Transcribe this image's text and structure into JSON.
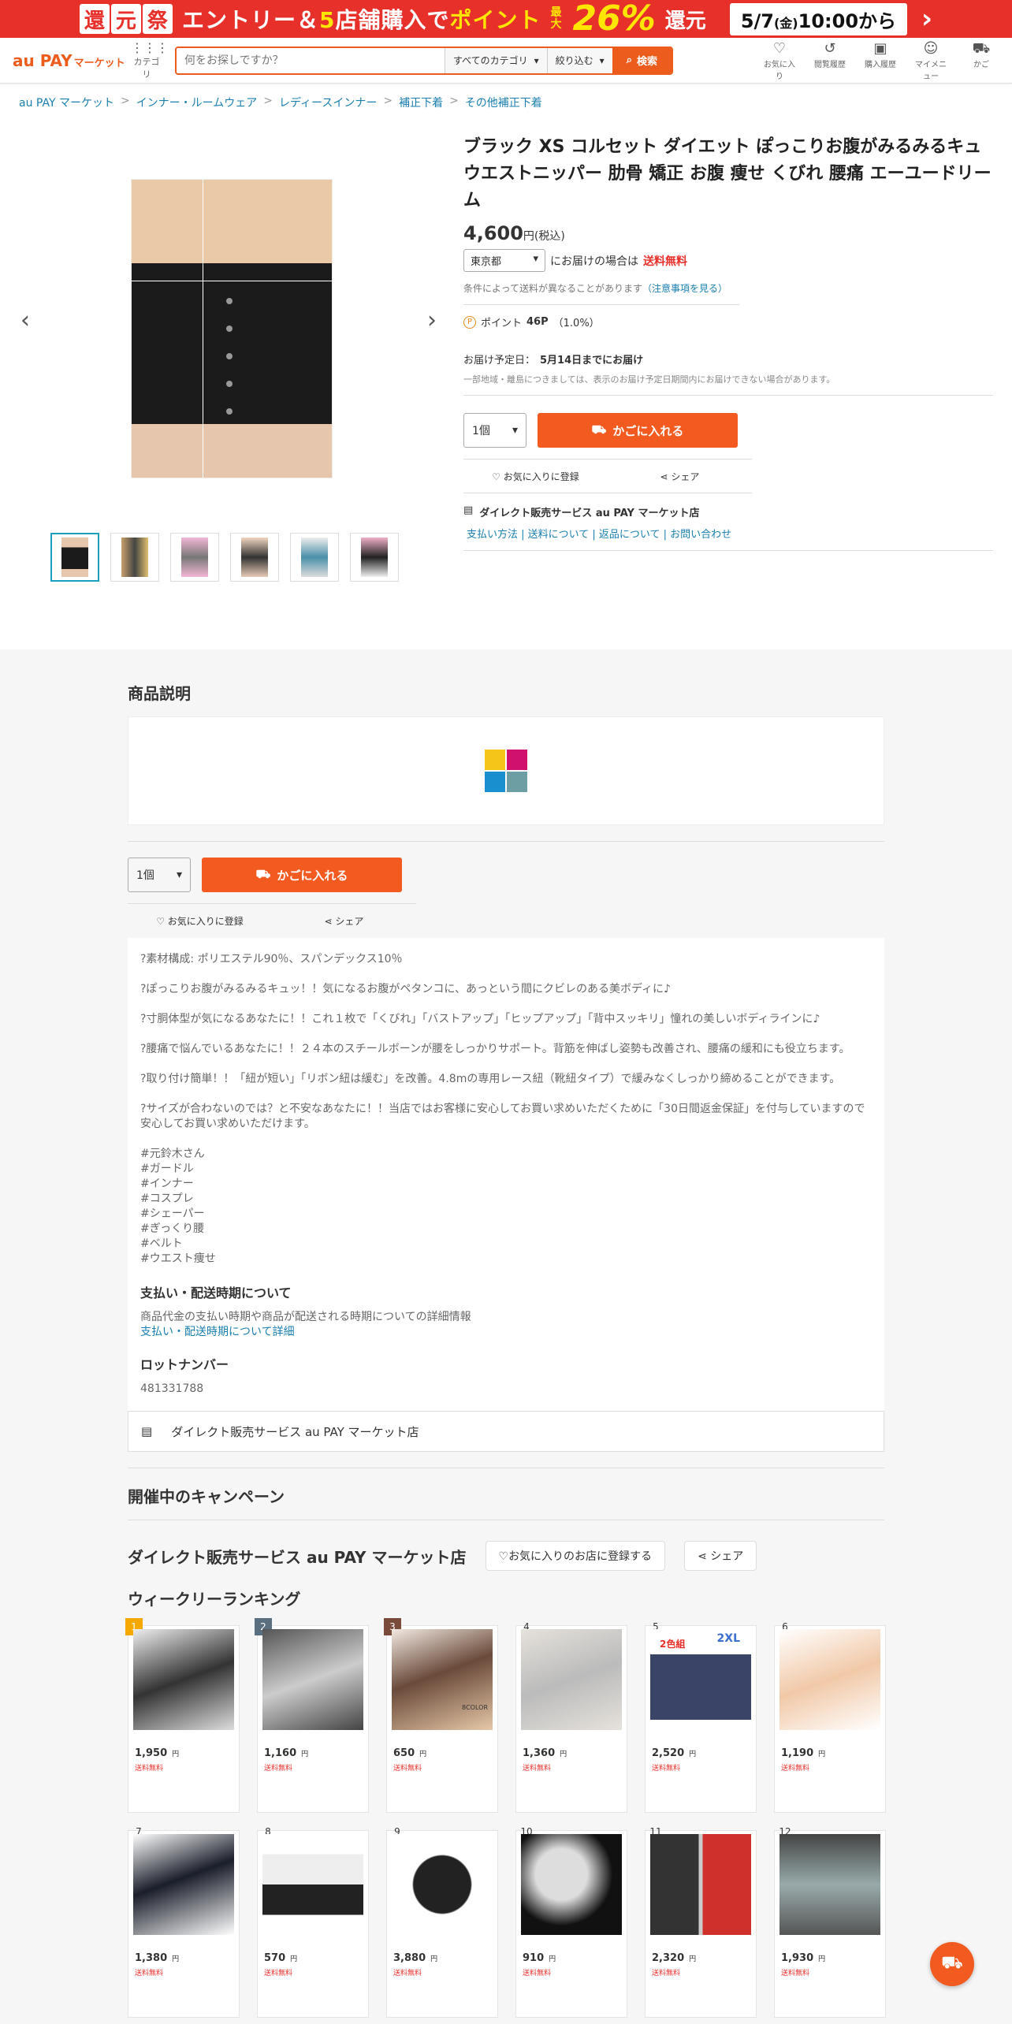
{
  "banner": {
    "k1": "還",
    "k2": "元",
    "k3": "祭",
    "text1": "エントリー＆",
    "five": "5",
    "text2": "店舗購入で",
    "point": "ポイント",
    "max": "最大",
    "pct": "26%",
    "kangen": "還元",
    "date": "5/7",
    "dow": "(金)",
    "time": "10:00から"
  },
  "header": {
    "logo": "au PAY",
    "logo_sub": "マーケット",
    "category": "カテゴリ",
    "search_placeholder": "何をお探しですか？",
    "all_category": "すべてのカテゴリ",
    "filter": "絞り込む",
    "search_btn": "検索",
    "icons": [
      {
        "label": "お気に入り",
        "icon": "heart-icon"
      },
      {
        "label": "閲覧履歴",
        "icon": "history-icon"
      },
      {
        "label": "購入履歴",
        "icon": "bag-icon"
      },
      {
        "label": "マイメニュー",
        "icon": "user-icon"
      },
      {
        "label": "かご",
        "icon": "cart-icon"
      }
    ]
  },
  "breadcrumbs": [
    "au PAY マーケット",
    "インナー・ルームウェア",
    "レディースインナー",
    "補正下着",
    "その他補正下着"
  ],
  "product": {
    "title": "ブラック XS コルセット ダイエット ぽっこりお腹がみるみるキュ ウエストニッパー 肋骨 矯正 お腹 痩せ くびれ 腰痛 エーユードリーム",
    "price": "4,600",
    "tax": "円(税込)",
    "pref": "東京都",
    "ship_text": "にお届けの場合は",
    "ship_free": "送料無料",
    "cond": "条件によって送料が異なることがあります",
    "cond_link": "（注意事項を見る）",
    "point_label": "ポイント",
    "point_val": "46P",
    "point_rate": "（1.0%）",
    "deliv_label": "お届け予定日：",
    "deliv_val": "5月14日までにお届け",
    "deliv_note": "一部地域・離島につきましては、表示のお届け予定日期間内にお届けできない場合があります。",
    "qty": "1個",
    "cart": "かごに入れる",
    "fav": "お気に入りに登録",
    "share": "シェア",
    "seller": "ダイレクト販売サービス au PAY マーケット店",
    "seller_links": "支払い方法 | 送料について | 返品について | お問い合わせ"
  },
  "desc": {
    "heading": "商品説明",
    "qty": "1個",
    "cart": "かごに入れる",
    "fav": "お気に入りに登録",
    "share": "シェア",
    "paras": [
      "?素材構成: ポリエステル90％、スパンデックス10％",
      "?ぽっこりお腹がみるみるキュッ！！気になるお腹がペタンコに、あっという間にクビレのある美ボディに♪",
      "?寸胴体型が気になるあなたに！！これ１枚で「くびれ」「バストアップ」「ヒップアップ」「背中スッキリ」憧れの美しいボディラインに♪",
      "?腰痛で悩んでいるあなたに！！２４本のスチールボーンが腰をしっかりサポート。背筋を伸ばし姿勢も改善され、腰痛の緩和にも役立ちます。",
      "?取り付け簡単！！「紐が短い」「リボン紐は緩む」を改善。4.8mの専用レース紐（靴紐タイプ）で緩みなくしっかり締めることができます。",
      "?サイズが合わないのでは？と不安なあなたに！！当店ではお客様に安心してお買い求めいただくために「30日間返金保証」を付与していますので安心してお買い求めいただけます。"
    ],
    "tags": [
      "#元鈴木さん",
      "#ガードル",
      "#インナー",
      "#コスプレ",
      "#シェーパー",
      "#ぎっくり腰",
      "#ベルト",
      "#ウエスト痩せ"
    ],
    "pay_heading": "支払い・配送時期について",
    "pay_text": "商品代金の支払い時期や商品が配送される時期についての詳細情報",
    "pay_link": "支払い・配送時期について詳細",
    "lot_heading": "ロットナンバー",
    "lot": "481331788",
    "seller": "ダイレクト販売サービス au PAY マーケット店"
  },
  "campaign": "開催中のキャンペーン",
  "shop": {
    "name": "ダイレクト販売サービス au PAY マーケット店",
    "fav": "お気に入りのお店に登録する",
    "share": "シェア"
  },
  "ranking": {
    "heading": "ウィークリーランキング",
    "yen": "円",
    "free": "送料無料",
    "items": [
      {
        "rank": "1",
        "price": "1,950"
      },
      {
        "rank": "2",
        "price": "1,160"
      },
      {
        "rank": "3",
        "price": "650"
      },
      {
        "rank": "4",
        "price": "1,360"
      },
      {
        "rank": "5",
        "price": "2,520"
      },
      {
        "rank": "6",
        "price": "1,190"
      },
      {
        "rank": "7",
        "price": "1,380"
      },
      {
        "rank": "8",
        "price": "570"
      },
      {
        "rank": "9",
        "price": "3,880"
      },
      {
        "rank": "10",
        "price": "910"
      },
      {
        "rank": "11",
        "price": "2,320"
      },
      {
        "rank": "12",
        "price": "1,930"
      }
    ],
    "img_text_5a": "2色組",
    "img_text_5b": "2XL",
    "img_text_3": "8COLOR"
  },
  "colors": {
    "accent": "#f25a1f",
    "banner": "#e8302b",
    "link": "#1a7faf",
    "rank1": "#f5a800",
    "rank2": "#5a7080",
    "rank3": "#7a4a3a"
  }
}
